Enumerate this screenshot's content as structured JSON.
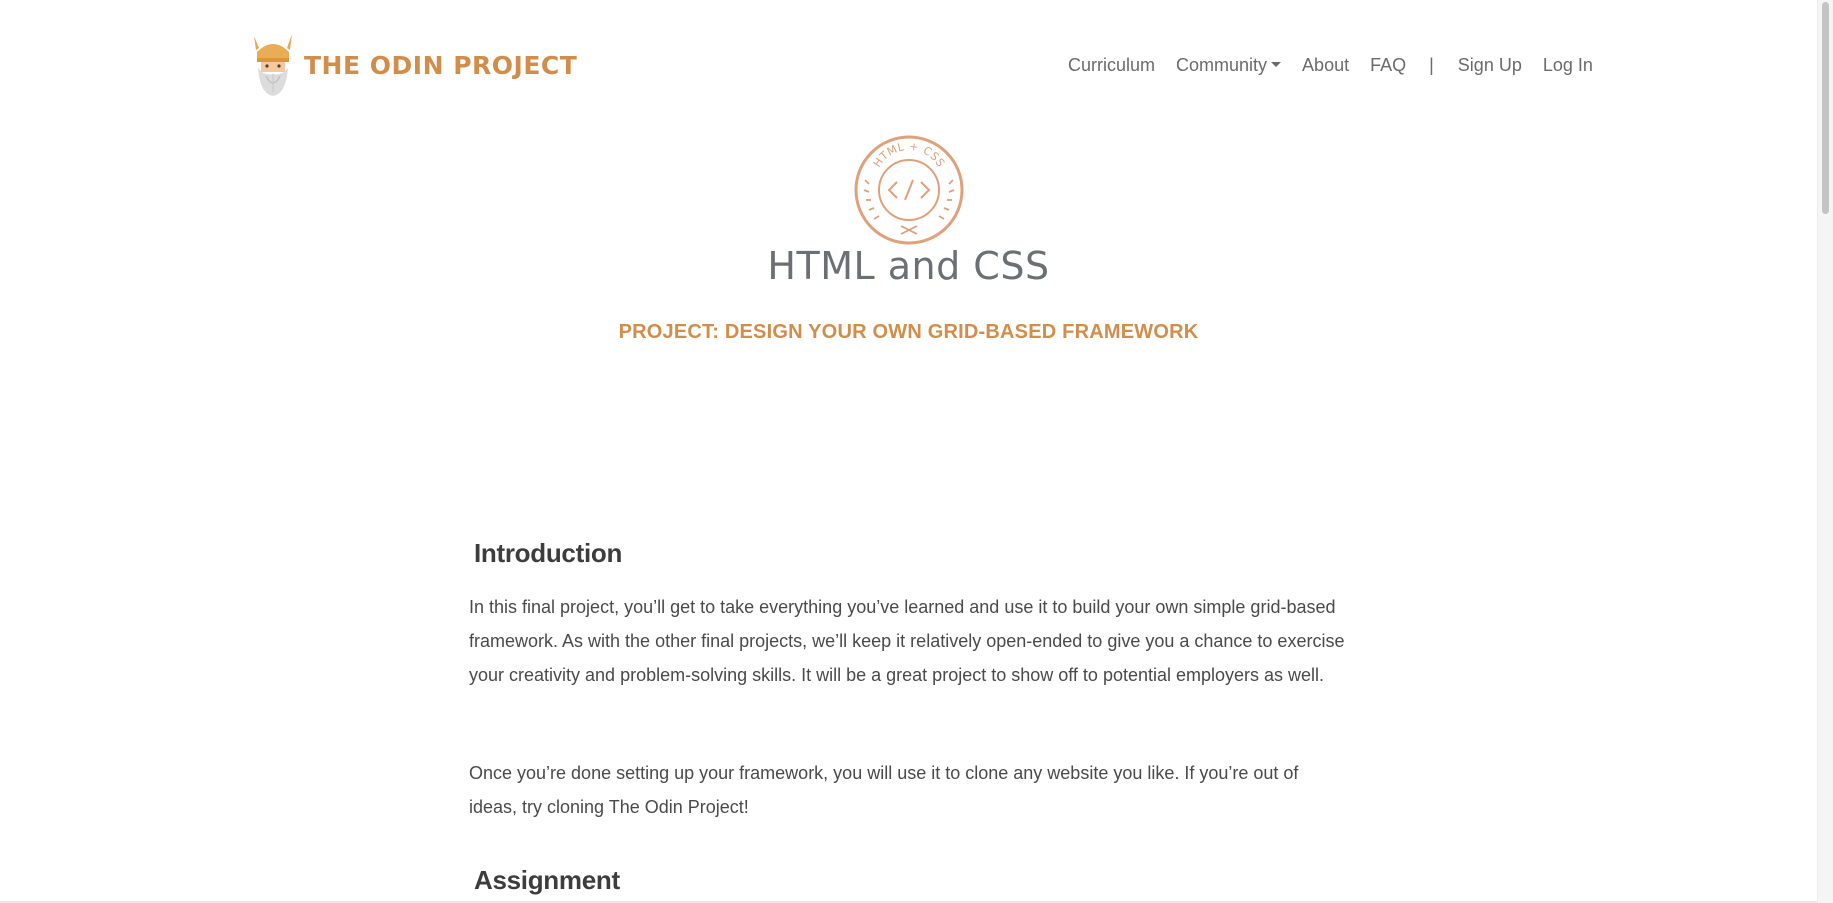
{
  "brand": {
    "name": "THE ODIN PROJECT",
    "logo_icon": "odin-viking-logo-icon",
    "color": "#d28d4b"
  },
  "nav": {
    "items": [
      {
        "label": "Curriculum"
      },
      {
        "label": "Community",
        "has_dropdown": true
      },
      {
        "label": "About"
      },
      {
        "label": "FAQ"
      }
    ],
    "separator": "|",
    "auth": [
      {
        "label": "Sign Up"
      },
      {
        "label": "Log In"
      }
    ]
  },
  "hero": {
    "badge_text": "HTML + CSS",
    "badge_icon": "code-brackets-badge-icon",
    "title": "HTML and CSS",
    "subtitle": "PROJECT: DESIGN YOUR OWN GRID-BASED FRAMEWORK"
  },
  "content": {
    "introduction": {
      "heading": "Introduction",
      "paragraph_1": "In this final project, you’ll get to take everything you’ve learned and use it to build your own simple grid-based framework. As with the other final projects, we’ll keep it relatively open-ended to give you a chance to exercise your creativity and problem-solving skills. It will be a great project to show off to potential employers as well.",
      "paragraph_2": "Once you’re done setting up your framework, you will use it to clone any website you like. If you’re out of ideas, try cloning The Odin Project!"
    },
    "assignment": {
      "heading": "Assignment"
    }
  },
  "colors": {
    "accent": "#d28d4b",
    "title_gray": "#6c6f73",
    "body_text": "#4a4a4a",
    "nav_text": "#6b6b6b"
  }
}
